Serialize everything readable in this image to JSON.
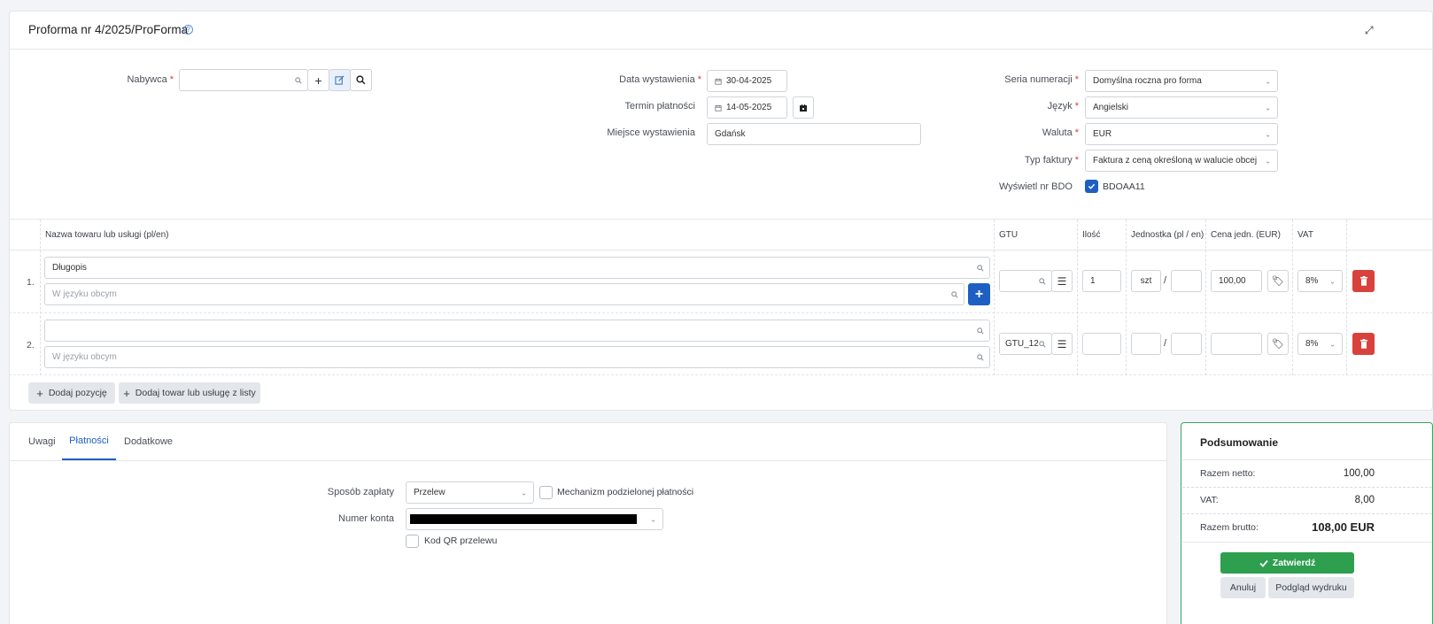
{
  "header": {
    "title": "Proforma nr 4/2025/ProForma"
  },
  "buyer": {
    "label": "Nabywca"
  },
  "dates": {
    "issue_label": "Data wystawienia",
    "issue_value": "30-04-2025",
    "due_label": "Termin płatności",
    "due_value": "14-05-2025",
    "place_label": "Miejsce wystawienia",
    "place_value": "Gdańsk"
  },
  "settings": {
    "series_label": "Seria numeracji",
    "series_value": "Domyślna roczna pro forma",
    "lang_label": "Język",
    "lang_value": "Angielski",
    "currency_label": "Waluta",
    "currency_value": "EUR",
    "type_label": "Typ faktury",
    "type_value": "Faktura z ceną określoną w walucie obcej",
    "bdo_label": "Wyświetl nr BDO",
    "bdo_value": "BDOAA11",
    "bdo_checked": true
  },
  "table": {
    "headers": {
      "name": "Nazwa towaru lub usługi (pl/en)",
      "gtu": "GTU",
      "qty": "Ilość",
      "unit": "Jednostka (pl / en)",
      "price": "Cena jedn. (EUR)",
      "vat": "VAT"
    },
    "rows": [
      {
        "num": "1.",
        "name": "Długopis",
        "foreign_placeholder": "W języku obcym",
        "gtu": "",
        "qty": "1",
        "unit_pl": "szt",
        "unit_en": "",
        "price": "100,00",
        "vat": "8%"
      },
      {
        "num": "2.",
        "name": "",
        "foreign_placeholder": "W języku obcym",
        "gtu": "GTU_12",
        "qty": "",
        "unit_pl": "",
        "unit_en": "",
        "price": "",
        "vat": "8%"
      }
    ],
    "add_position": "Dodaj pozycję",
    "add_from_list": "Dodaj towar lub usługę z listy"
  },
  "tabs": [
    "Uwagi",
    "Płatności",
    "Dodatkowe"
  ],
  "active_tab": "Płatności",
  "payment": {
    "method_label": "Sposób zapłaty",
    "method_value": "Przelew",
    "split_label": "Mechanizm podzielonej płatności",
    "account_label": "Numer konta",
    "qr_label": "Kod QR przelewu"
  },
  "summary": {
    "title": "Podsumowanie",
    "net_label": "Razem netto:",
    "net_value": "100,00",
    "vat_label": "VAT:",
    "vat_value": "8,00",
    "gross_label": "Razem brutto:",
    "gross_value": "108,00 EUR",
    "confirm": "Zatwierdź",
    "cancel": "Anuluj",
    "preview": "Podgląd wydruku"
  },
  "colors": {
    "primary": "#1e5fc4",
    "success": "#2e9e4f",
    "danger": "#d9423c"
  }
}
